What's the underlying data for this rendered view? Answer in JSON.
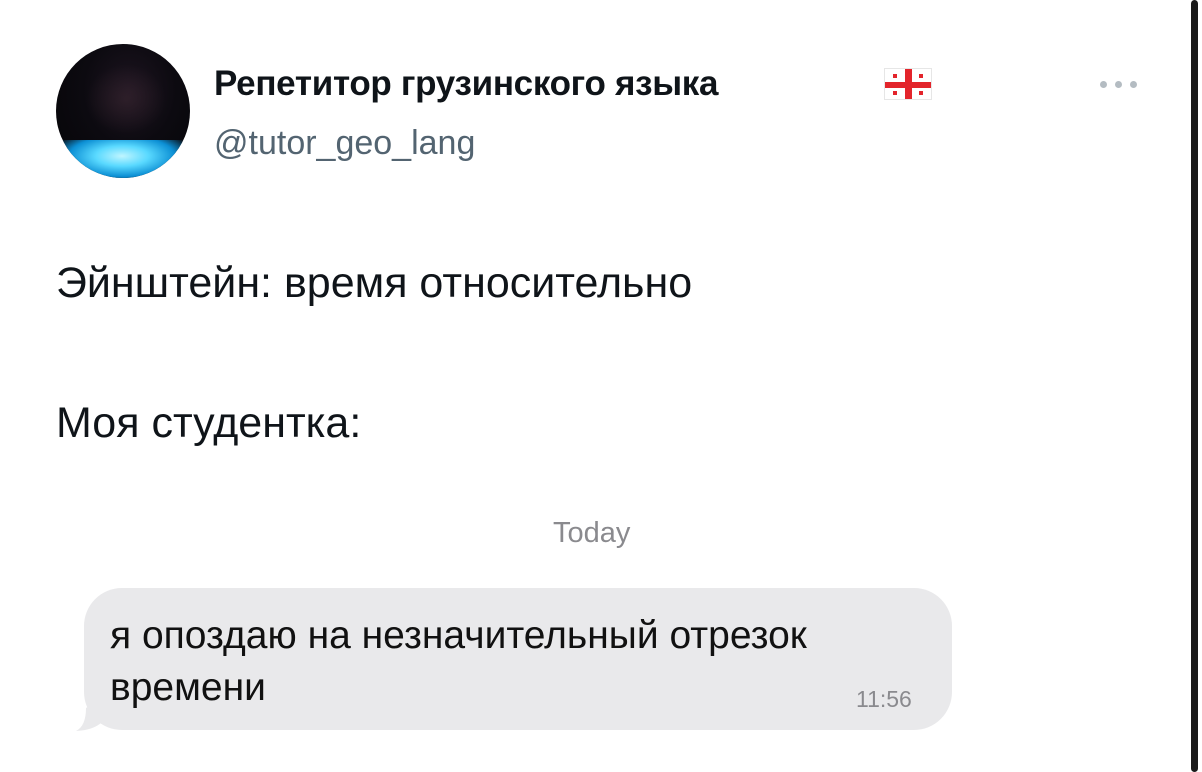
{
  "author": {
    "name": "Репетитор грузинского языка",
    "handle": "@tutor_geo_lang",
    "flag_icon": "georgia-flag"
  },
  "tweet": {
    "line1": "Эйнштейн: время относительно",
    "line2": "Моя студентка:"
  },
  "chat": {
    "day_label": "Today",
    "message": "я опоздаю на незначительный отрезок времени",
    "time": "11:56"
  },
  "icons": {
    "more": "more-horizontal-icon"
  },
  "colors": {
    "text": "#0f1419",
    "secondary": "#536471",
    "bubble": "#e9e9eb",
    "flag_red": "#e3242b"
  }
}
